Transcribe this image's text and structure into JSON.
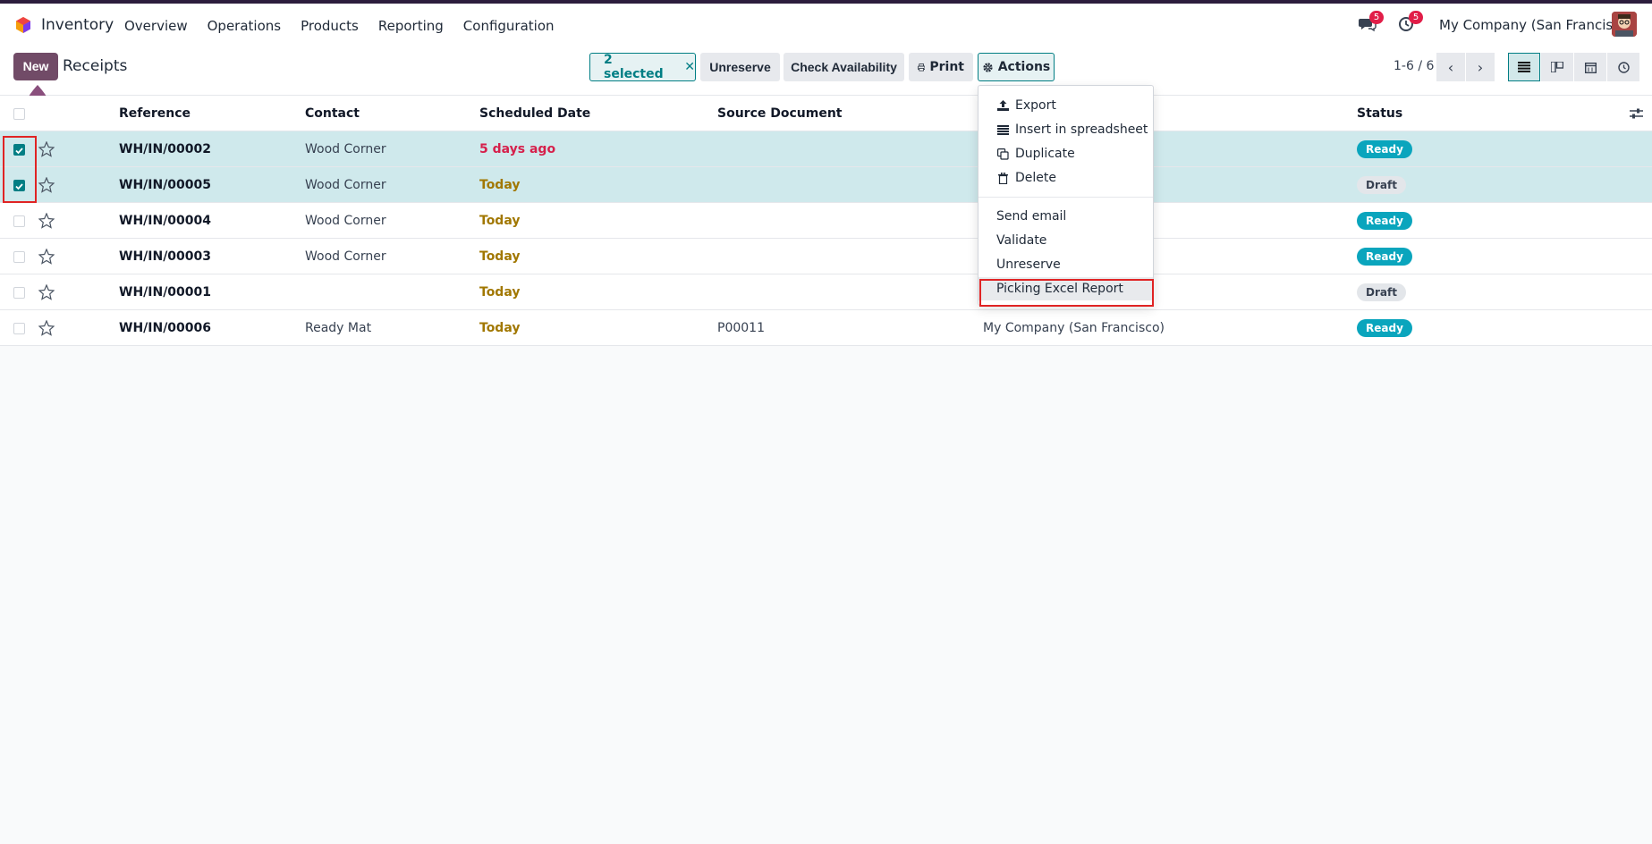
{
  "navbar": {
    "app_name": "Inventory",
    "menu": [
      "Overview",
      "Operations",
      "Products",
      "Reporting",
      "Configuration"
    ],
    "messages_count": "5",
    "activities_count": "5",
    "company": "My Company (San Francisco)"
  },
  "control": {
    "new_label": "New",
    "title": "Receipts",
    "selected_label": "2 selected",
    "unreserve_label": "Unreserve",
    "check_availability_label": "Check Availability",
    "print_label": "Print",
    "actions_label": "Actions",
    "pager": "1-6 / 6"
  },
  "table": {
    "headers": {
      "reference": "Reference",
      "contact": "Contact",
      "scheduled_date": "Scheduled Date",
      "source_document": "Source Document",
      "status": "Status"
    },
    "rows": [
      {
        "reference": "WH/IN/00002",
        "contact": "Wood Corner",
        "date": "5 days ago",
        "source": "",
        "company": "",
        "status": "Ready",
        "selected": true
      },
      {
        "reference": "WH/IN/00005",
        "contact": "Wood Corner",
        "date": "Today",
        "source": "",
        "company": "",
        "status": "Draft",
        "selected": true
      },
      {
        "reference": "WH/IN/00004",
        "contact": "Wood Corner",
        "date": "Today",
        "source": "",
        "company": "",
        "status": "Ready",
        "selected": false
      },
      {
        "reference": "WH/IN/00003",
        "contact": "Wood Corner",
        "date": "Today",
        "source": "",
        "company": "",
        "status": "Ready",
        "selected": false
      },
      {
        "reference": "WH/IN/00001",
        "contact": "",
        "date": "Today",
        "source": "",
        "company": "",
        "status": "Draft",
        "selected": false
      },
      {
        "reference": "WH/IN/00006",
        "contact": "Ready Mat",
        "date": "Today",
        "source": "P00011",
        "company": "My Company (San Francisco)",
        "status": "Ready",
        "selected": false
      }
    ]
  },
  "actions_menu": {
    "export": "Export",
    "insert_spreadsheet": "Insert in spreadsheet",
    "duplicate": "Duplicate",
    "delete": "Delete",
    "send_email": "Send email",
    "validate": "Validate",
    "unreserve": "Unreserve",
    "picking_excel_report": "Picking Excel Report"
  },
  "colors": {
    "brand": "#714b67",
    "accent": "#017e84",
    "ready": "#0aa5bd",
    "late": "#d6204b",
    "today": "#a17700",
    "highlight": "#e02424"
  }
}
